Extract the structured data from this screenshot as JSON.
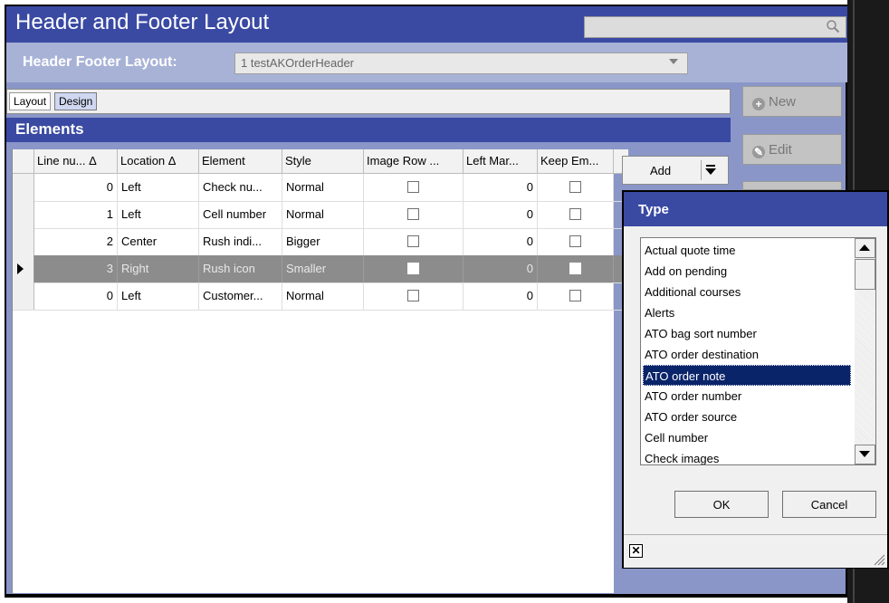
{
  "window": {
    "title": "Header and Footer Layout"
  },
  "header_footer": {
    "label": "Header Footer Layout:",
    "selected": "1 testAKOrderHeader"
  },
  "tabs": [
    {
      "label": "Layout"
    },
    {
      "label": "Design"
    }
  ],
  "elements": {
    "title": "Elements"
  },
  "grid": {
    "columns": [
      "Line nu... Δ",
      "Location Δ",
      "Element",
      "Style",
      "Image Row ...",
      "Left Mar...",
      "Keep Em..."
    ],
    "rows": [
      {
        "line": "0",
        "location": "Left",
        "element": "Check nu...",
        "style": "Normal",
        "image_row": false,
        "left_margin": "0",
        "keep_empty": false
      },
      {
        "line": "1",
        "location": "Left",
        "element": "Cell number",
        "style": "Normal",
        "image_row": false,
        "left_margin": "0",
        "keep_empty": false
      },
      {
        "line": "2",
        "location": "Center",
        "element": "Rush indi...",
        "style": "Bigger",
        "image_row": false,
        "left_margin": "0",
        "keep_empty": false
      },
      {
        "line": "3",
        "location": "Right",
        "element": "Rush icon",
        "style": "Smaller",
        "image_row": false,
        "left_margin": "0",
        "keep_empty": false,
        "selected": true
      },
      {
        "line": "0",
        "location": "Left",
        "element": "Customer...",
        "style": "Normal",
        "image_row": false,
        "left_margin": "0",
        "keep_empty": false
      }
    ]
  },
  "side_buttons": {
    "new": "New",
    "edit": "Edit"
  },
  "add_button": {
    "label": "Add"
  },
  "type_popup": {
    "title": "Type",
    "items": [
      "Actual quote time",
      "Add on pending",
      "Additional courses",
      "Alerts",
      "ATO bag sort number",
      "ATO order destination",
      "ATO order note",
      "ATO order number",
      "ATO order source",
      "Cell number",
      "Check images"
    ],
    "selected": "ATO order note",
    "ok": "OK",
    "cancel": "Cancel"
  },
  "colors": {
    "title_bar": "#3a4aa3",
    "panel": "#8a96c8",
    "selection": "#0a246a",
    "row_selected": "#8c8c8c"
  }
}
